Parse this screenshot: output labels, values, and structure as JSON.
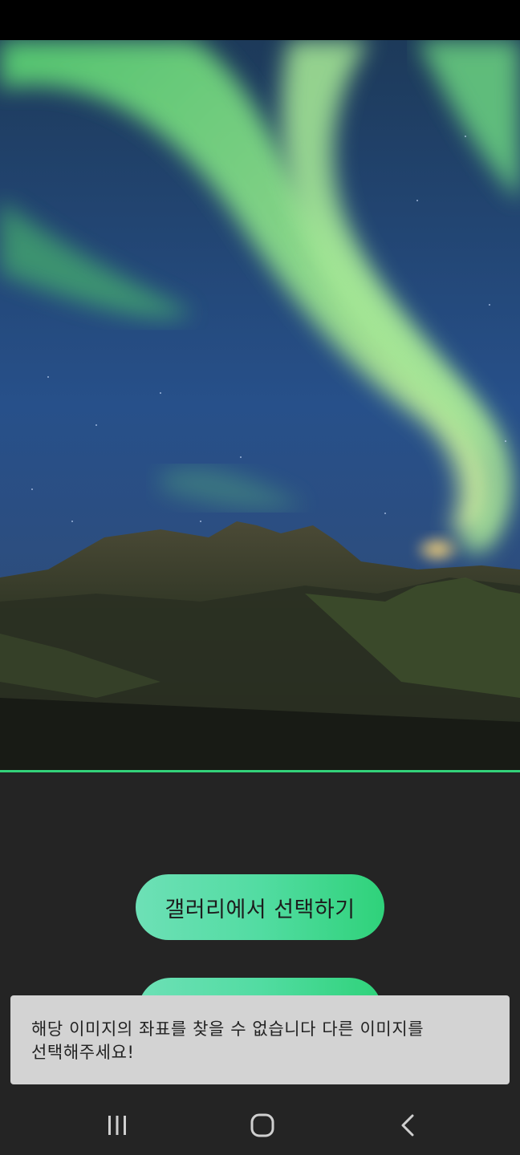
{
  "hero": {
    "image_alt": "aurora-over-mountains-photo"
  },
  "buttons": {
    "gallery_label": "갤러리에서 선택하기",
    "second_label": ""
  },
  "toast": {
    "line1": "해당 이미지의 좌표를 찾을 수 없습니다 다른 이미지를",
    "line2": "선택해주세요!"
  },
  "nav": {
    "recents_icon": "recent-apps-icon",
    "home_icon": "home-icon",
    "back_icon": "back-icon"
  },
  "colors": {
    "accent": "#33d17a",
    "background": "#242424",
    "toast_bg": "#d3d3d3"
  }
}
